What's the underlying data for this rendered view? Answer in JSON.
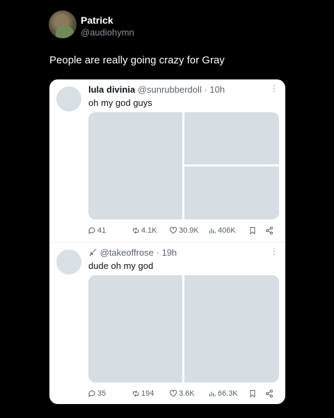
{
  "author": {
    "name": "Patrick",
    "handle": "@audiohymn",
    "text": "People are really going crazy for Gray",
    "avatar_icon": "avatar-photo"
  },
  "quoted_posts": [
    {
      "name": "lula divinia",
      "handle": "@sunrubberdoll",
      "time": "· 10h",
      "text": "oh my god guys",
      "more": "⋮",
      "media_layout": "one-left-two-right",
      "replies": "41",
      "reposts": "4.1K",
      "likes": "30.9K",
      "views": "406K"
    },
    {
      "name_icon": "sword-emoji",
      "handle": "@takeoffrose",
      "time": "· 19h",
      "text": "dude oh my god",
      "more": "⋮",
      "media_layout": "two-columns",
      "replies": "35",
      "reposts": "194",
      "likes": "3.6K",
      "views": "66.3K"
    }
  ],
  "icons": {
    "reply": "reply-icon",
    "repost": "repost-icon",
    "like": "heart-icon",
    "views": "views-icon",
    "bookmark": "bookmark-icon",
    "share": "share-icon"
  },
  "colors": {
    "background": "#000000",
    "card": "#ffffff",
    "media_placeholder": "#d6dee4",
    "muted_text": "#8b8f95"
  }
}
